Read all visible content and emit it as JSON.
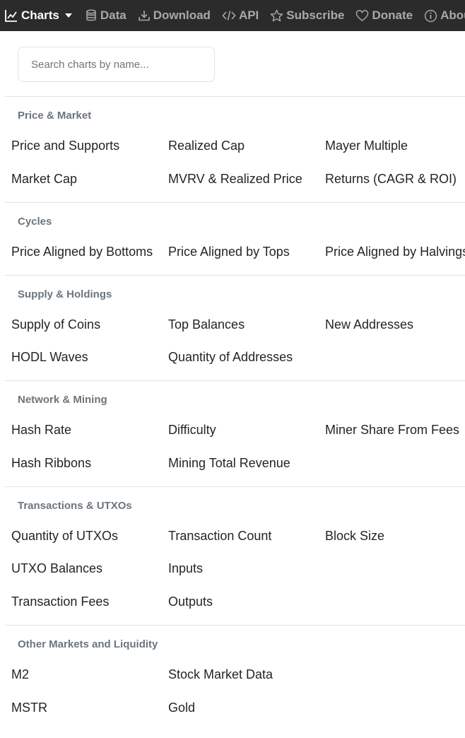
{
  "nav": {
    "charts": "Charts",
    "data": "Data",
    "download": "Download",
    "api": "API",
    "subscribe": "Subscribe",
    "donate": "Donate",
    "about": "About"
  },
  "search": {
    "placeholder": "Search charts by name..."
  },
  "sections": [
    {
      "title": "Price & Market",
      "items": [
        "Price and Supports",
        "Realized Cap",
        "Mayer Multiple",
        "Market Cap",
        "MVRV & Realized Price",
        "Returns (CAGR & ROI)"
      ]
    },
    {
      "title": "Cycles",
      "items": [
        "Price Aligned by Bottoms",
        "Price Aligned by Tops",
        "Price Aligned by Halvings"
      ]
    },
    {
      "title": "Supply & Holdings",
      "items": [
        "Supply of Coins",
        "Top Balances",
        "New Addresses",
        "HODL Waves",
        "Quantity of Addresses"
      ]
    },
    {
      "title": "Network & Mining",
      "items": [
        "Hash Rate",
        "Difficulty",
        "Miner Share From Fees",
        "Hash Ribbons",
        "Mining Total Revenue"
      ]
    },
    {
      "title": "Transactions & UTXOs",
      "items": [
        "Quantity of UTXOs",
        "Transaction Count",
        "Block Size",
        "UTXO Balances",
        "Inputs",
        "Transaction Fees",
        "Outputs"
      ]
    },
    {
      "title": "Other Markets and Liquidity",
      "items": [
        "M2",
        "Stock Market Data",
        "MSTR",
        "Gold"
      ]
    }
  ]
}
